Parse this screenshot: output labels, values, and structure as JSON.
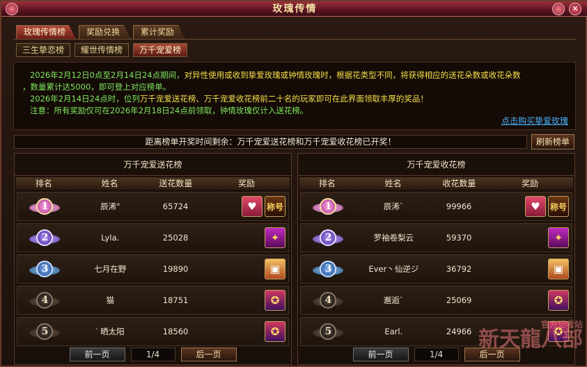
{
  "window": {
    "title": "玫瑰传情"
  },
  "tabs": [
    {
      "label": "玫瑰传情榜",
      "active": true
    },
    {
      "label": "奖励兑换",
      "active": false
    },
    {
      "label": "累计奖励",
      "active": false
    }
  ],
  "subtabs": [
    {
      "label": "三生挚恋榜",
      "active": false
    },
    {
      "label": "耀世传情榜",
      "active": false
    },
    {
      "label": "万千宠爱榜",
      "active": true
    }
  ],
  "info": {
    "line1_a": "2026年2月12日0点至2月14日24点期间，",
    "line1_b": "对异性使用或收到挚爱玫瑰或钟情玫瑰时，根据花类型不同，将获得相应的送花朵数或收花朵数",
    "line2": "，数量累计达5000，即可登上对应榜单。",
    "line3_a": "2026年2月14日24点时，位列",
    "line3_b": "万千宠爱送花榜、万千宠爱收花榜前二十名的玩家即可在此界面领取丰厚的奖品！",
    "line4": "注意：所有奖励仅可在2026年2月18日24点前领取，钟情玫瑰仅计入送花榜。",
    "buy_link": "点击购买挚爱玫瑰"
  },
  "notice": "距离榜单开奖时间剩余：万千宠爱送花榜和万千宠爱收花榜已开奖！",
  "refresh_label": "刷新榜单",
  "left_panel": {
    "title": "万千宠爱送花榜",
    "headers": [
      "排名",
      "姓名",
      "送花数量",
      "奖励"
    ],
    "rows": [
      {
        "rank": "1",
        "name": "辰浠\"",
        "count": "65724",
        "rewards": [
          "title",
          "badge"
        ]
      },
      {
        "rank": "2",
        "name": "Lyla.",
        "count": "25028",
        "rewards": [
          "gift"
        ]
      },
      {
        "rank": "3",
        "name": "七月在野",
        "count": "19890",
        "rewards": [
          "box"
        ]
      },
      {
        "rank": "4",
        "name": "猫",
        "count": "18751",
        "rewards": [
          "chest"
        ]
      },
      {
        "rank": "5",
        "name": "′ 晒太阳",
        "count": "18560",
        "rewards": [
          "chest"
        ]
      }
    ],
    "pager": {
      "prev": "前一页",
      "page": "1/4",
      "next": "后一页"
    }
  },
  "right_panel": {
    "title": "万千宠爱收花榜",
    "headers": [
      "排名",
      "姓名",
      "收花数量",
      "奖励"
    ],
    "rows": [
      {
        "rank": "1",
        "name": "辰浠`",
        "count": "99966",
        "rewards": [
          "title",
          "badge"
        ]
      },
      {
        "rank": "2",
        "name": "罗袖卷梨云",
        "count": "59370",
        "rewards": [
          "gift"
        ]
      },
      {
        "rank": "3",
        "name": "Ever丶仙逆ジ",
        "count": "36792",
        "rewards": [
          "box"
        ]
      },
      {
        "rank": "4",
        "name": "邂逅`",
        "count": "25069",
        "rewards": [
          "chest"
        ]
      },
      {
        "rank": "5",
        "name": "Earl.",
        "count": "24966",
        "rewards": [
          "chest"
        ]
      }
    ],
    "pager": {
      "prev": "前一页",
      "page": "1/4",
      "next": "后一页"
    }
  },
  "reward_glyphs": {
    "title": "♥",
    "badge": "称号",
    "gift": "✦",
    "box": "▣",
    "chest": "✪"
  },
  "watermark": {
    "line1": "官方记者站",
    "line2": "新天龍八部"
  }
}
